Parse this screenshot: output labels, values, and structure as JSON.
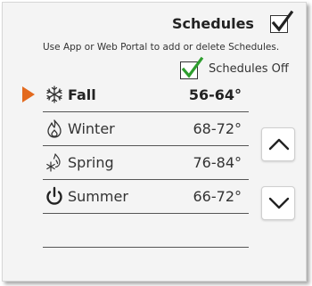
{
  "header": {
    "title": "Schedules",
    "title_checked": true,
    "subtitle": "Use App or Web Portal to add or delete Schedules.",
    "schedules_off_label": "Schedules Off",
    "schedules_off_checked": true
  },
  "schedules": [
    {
      "name": "Fall",
      "temp": "56-64°",
      "icon": "snowflake-icon",
      "selected": true
    },
    {
      "name": "Winter",
      "temp": "68-72°",
      "icon": "flame-icon",
      "selected": false
    },
    {
      "name": "Spring",
      "temp": "76-84°",
      "icon": "flame-snowflake-icon",
      "selected": false
    },
    {
      "name": "Summer",
      "temp": "66-72°",
      "icon": "power-icon",
      "selected": false
    }
  ],
  "nav": {
    "up_icon": "chevron-up-icon",
    "down_icon": "chevron-down-icon"
  },
  "colors": {
    "accent": "#e36a1e",
    "check_green": "#2e9e2e",
    "check_dark": "#222222"
  }
}
